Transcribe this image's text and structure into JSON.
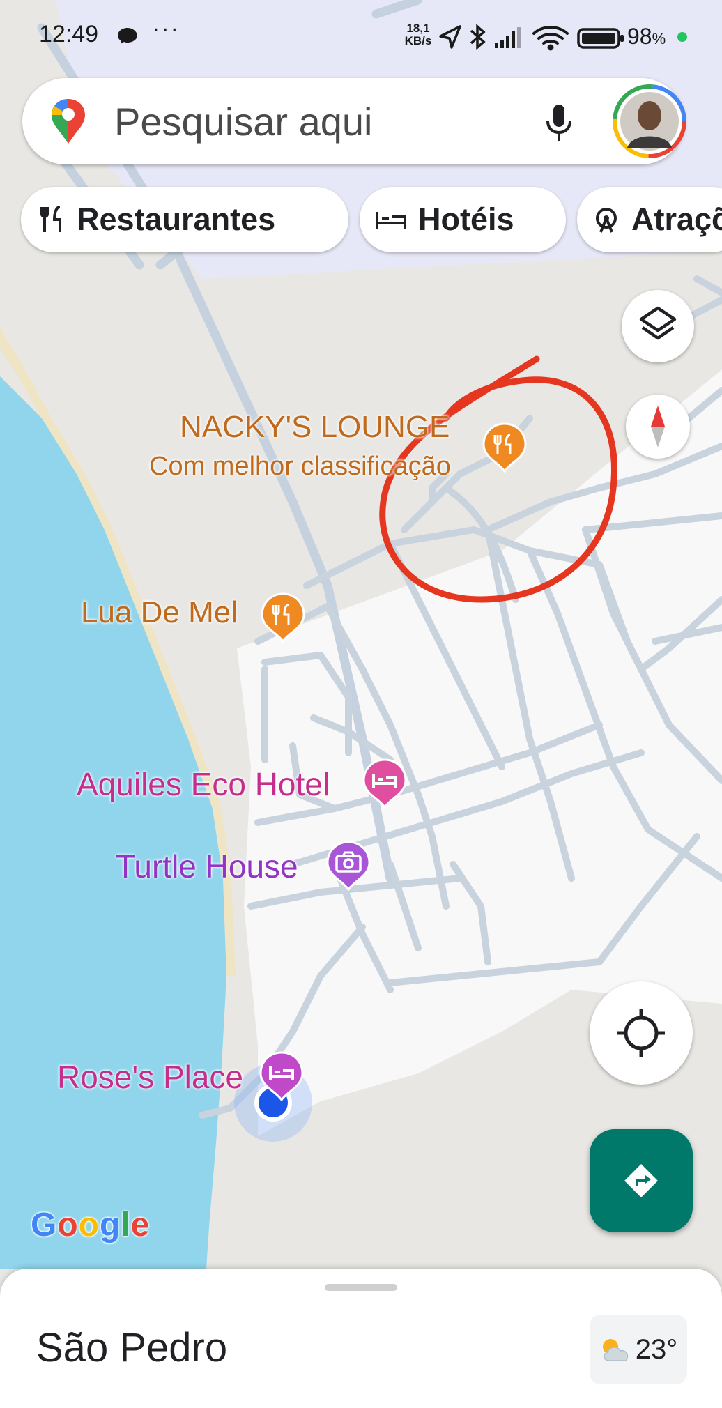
{
  "status_bar": {
    "time": "12:49",
    "net_speed_value": "18,1",
    "net_speed_unit": "KB/s",
    "battery_value": "98",
    "battery_unit": "%",
    "icons": [
      "chat-bubble-icon",
      "more-dots-icon",
      "location-arrow-icon",
      "bluetooth-icon",
      "signal-icon",
      "wifi-icon",
      "battery-icon"
    ]
  },
  "search": {
    "placeholder": "Pesquisar aqui",
    "icons": [
      "maps-pin-icon",
      "microphone-icon",
      "profile-avatar"
    ]
  },
  "chips": [
    {
      "label": "Restaurantes",
      "icon": "fork-knife-icon"
    },
    {
      "label": "Hotéis",
      "icon": "bed-icon"
    },
    {
      "label": "Atrações",
      "icon": "ferris-wheel-icon"
    }
  ],
  "map": {
    "places": [
      {
        "name": "NACKY'S LOUNGE",
        "subtitle": "Com melhor classificação",
        "category": "restaurant",
        "color": "#e8851d"
      },
      {
        "name": "Lua De Mel",
        "category": "restaurant",
        "color": "#e8851d"
      },
      {
        "name": "Aquiles Eco Hotel",
        "category": "hotel",
        "color": "#e04e9f"
      },
      {
        "name": "Turtle House",
        "category": "attraction",
        "color": "#a855d8"
      },
      {
        "name": "Rose's Place",
        "category": "hotel",
        "color": "#c049c9"
      }
    ],
    "annotation": "red hand-drawn circle",
    "user_location_color": "#1a73e8",
    "water_color": "#90d5ec",
    "land_color": "#e9e7e3"
  },
  "controls": {
    "layers": "layers-icon",
    "compass": "compass-icon",
    "locate": "my-location-icon",
    "directions": "directions-icon"
  },
  "google_logo": "Google",
  "bottom_sheet": {
    "title": "São Pedro",
    "weather_temp": "23°",
    "weather_icon": "partly-cloudy-icon"
  }
}
